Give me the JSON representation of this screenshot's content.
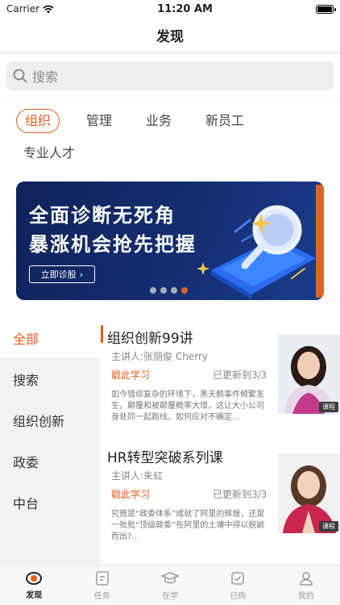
{
  "status_bar": {
    "carrier": "Carrier",
    "time": "11:20 AM"
  },
  "nav": {
    "title": "发现"
  },
  "search": {
    "placeholder": "搜索"
  },
  "tags": [
    "组织",
    "管理",
    "业务",
    "新员工",
    "专业人才"
  ],
  "active_tag": "组织",
  "banner": {
    "line1": "全面诊断无死角",
    "line2": "暴涨机会抢先把握",
    "button": "立即诊股",
    "dots": 4,
    "active_dot": 4
  },
  "sidebar": {
    "items": [
      {
        "label": "全部",
        "active": true
      },
      {
        "label": "搜索",
        "active": false
      },
      {
        "label": "组织创新",
        "active": false
      },
      {
        "label": "政委",
        "active": false
      },
      {
        "label": "中台",
        "active": false
      }
    ]
  },
  "courses": [
    {
      "title": "组织创新99讲",
      "lecturer": "主讲人:张丽俊 Cherry",
      "learn": "戳此学习",
      "updated": "已更新到3/3",
      "desc": "如今错综复杂的环境下，黑天鹅事件频繁发生，颠覆和被颠覆概率大增，这让大小公司身处同一起跑线。如何应对不确定...",
      "badge": "课程"
    },
    {
      "title": "HR转型突破系列课",
      "lecturer": "主讲人:朱虹",
      "learn": "戳此学习",
      "updated": "已更新到3/3",
      "desc": "究竟是“政委体系”成就了阿里的辉煌，还是一批批“顶级政委”在阿里的土壤中得以脱颖而出?...",
      "badge": "课程"
    }
  ],
  "tabbar": {
    "items": [
      {
        "label": "发现",
        "icon": "eye-icon",
        "active": true
      },
      {
        "label": "任务",
        "icon": "task-icon",
        "active": false
      },
      {
        "label": "在学",
        "icon": "graduation-cap-icon",
        "active": false
      },
      {
        "label": "已购",
        "icon": "purchased-icon",
        "active": false
      },
      {
        "label": "我的",
        "icon": "profile-icon",
        "active": false
      }
    ]
  },
  "colors": {
    "accent": "#e0621f",
    "banner_bg": "#152e72"
  }
}
